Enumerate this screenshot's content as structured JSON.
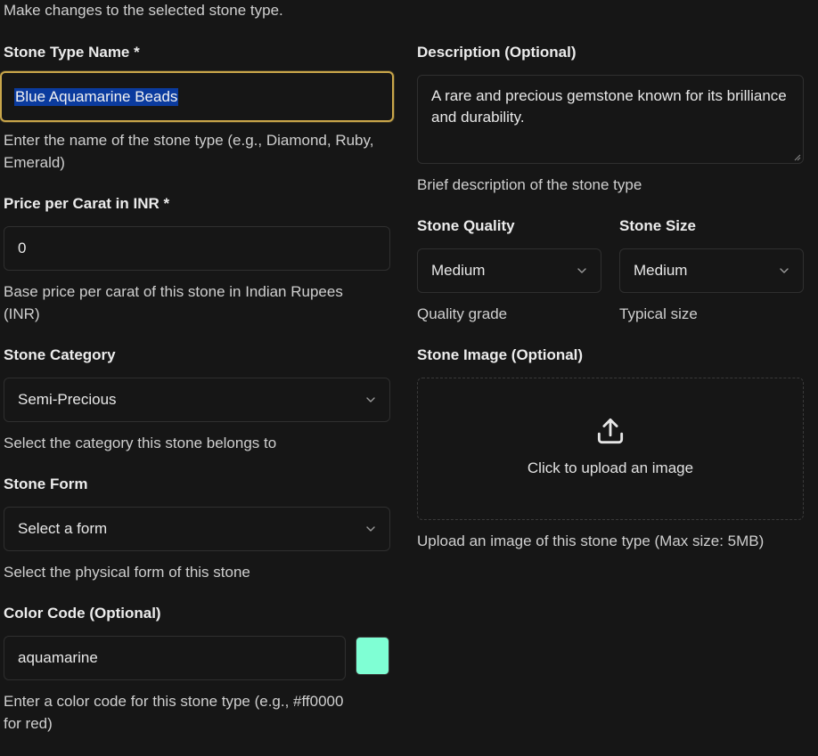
{
  "intro_text": "Make changes to the selected stone type.",
  "colors": {
    "background": "#161616",
    "focus_border": "#c9a64a",
    "selection": "#0b3b9e",
    "swatch": "#7fffd4"
  },
  "stone_name": {
    "label": "Stone Type Name *",
    "value": "Blue Aquamarine Beads",
    "help": "Enter the name of the stone type (e.g., Diamond, Ruby, Emerald)"
  },
  "price": {
    "label": "Price per Carat in INR *",
    "value": "0",
    "help": "Base price per carat of this stone in Indian Rupees (INR)"
  },
  "category": {
    "label": "Stone Category",
    "value": "Semi-Precious",
    "help": "Select the category this stone belongs to",
    "icon": "chevron-down-icon"
  },
  "form": {
    "label": "Stone Form",
    "value": "Select a form",
    "help": "Select the physical form of this stone",
    "icon": "chevron-down-icon"
  },
  "color_code": {
    "label": "Color Code (Optional)",
    "value": "aquamarine",
    "help": "Enter a color code for this stone type (e.g., #ff0000 for red)"
  },
  "description": {
    "label": "Description (Optional)",
    "value": "A rare and precious gemstone known for its brilliance and durability.",
    "help": "Brief description of the stone type"
  },
  "quality": {
    "label": "Stone Quality",
    "value": "Medium",
    "help": "Quality grade",
    "icon": "chevron-down-icon"
  },
  "size": {
    "label": "Stone Size",
    "value": "Medium",
    "help": "Typical size",
    "icon": "chevron-down-icon"
  },
  "image": {
    "label": "Stone Image (Optional)",
    "upload_text": "Click to upload an image",
    "help": "Upload an image of this stone type (Max size: 5MB)",
    "icon": "upload-icon"
  }
}
